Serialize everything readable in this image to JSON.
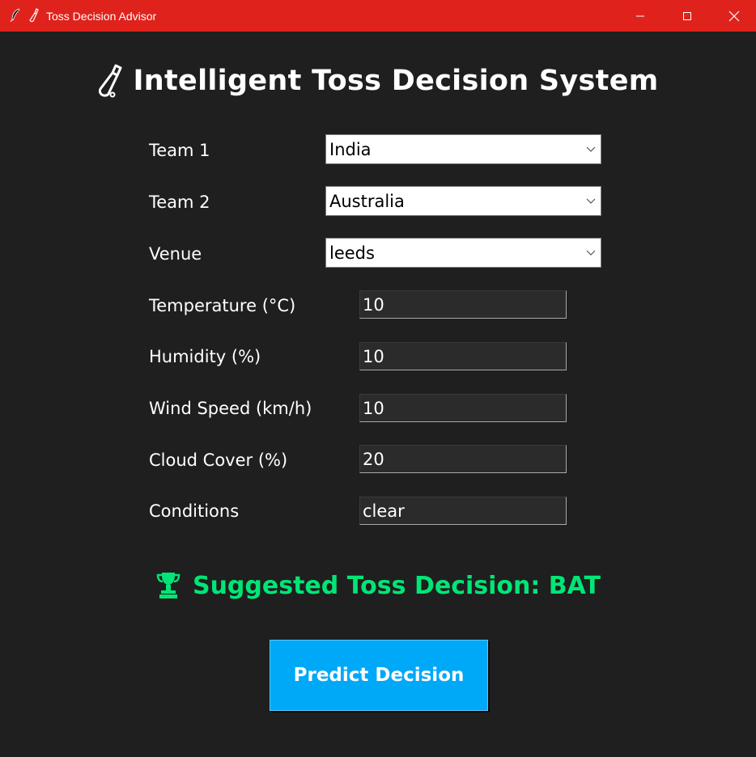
{
  "window": {
    "title": "Toss Decision Advisor",
    "app_icons": [
      "feather-icon",
      "cricket-bat-icon"
    ],
    "controls": [
      "minimize-icon",
      "maximize-icon",
      "close-icon"
    ],
    "titlebar_color": "#e0221c"
  },
  "heading": {
    "icon": "cricket-bat-icon",
    "text": "Intelligent Toss Decision System"
  },
  "form": {
    "team1": {
      "label": "Team 1",
      "value": "India"
    },
    "team2": {
      "label": "Team 2",
      "value": "Australia"
    },
    "venue": {
      "label": "Venue",
      "value": "leeds"
    },
    "temperature": {
      "label": "Temperature (°C)",
      "value": "10"
    },
    "humidity": {
      "label": "Humidity (%)",
      "value": "10"
    },
    "wind_speed": {
      "label": "Wind Speed (km/h)",
      "value": "10"
    },
    "cloud_cover": {
      "label": "Cloud Cover (%)",
      "value": "20"
    },
    "conditions": {
      "label": "Conditions",
      "value": "clear"
    }
  },
  "result": {
    "icon": "trophy-icon",
    "text": "Suggested Toss Decision: BAT",
    "color": "#00e676"
  },
  "predict_button": {
    "label": "Predict Decision",
    "color": "#00a8f8"
  }
}
